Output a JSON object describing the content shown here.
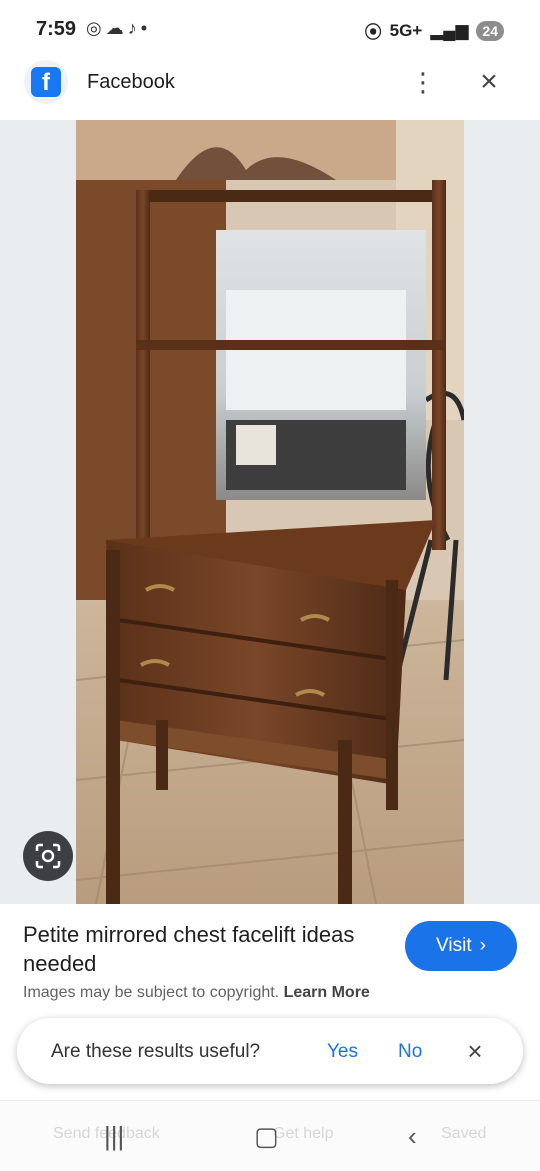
{
  "status": {
    "time": "7:59",
    "left_icons": [
      "whatsapp-icon",
      "cloud-icon",
      "tiktok-icon",
      "dot-icon"
    ],
    "network": "5G+",
    "battery": "24"
  },
  "header": {
    "title": "Facebook",
    "logo_icon": "facebook-icon",
    "logo_letter": "f",
    "accent": "#1877f2"
  },
  "result": {
    "title": "Petite mirrored chest facelift ideas needed",
    "visit_label": "Visit",
    "copyright_text": "Images may be subject to copyright.",
    "learn_more": "Learn More"
  },
  "feedback": {
    "question": "Are these results useful?",
    "yes": "Yes",
    "no": "No"
  },
  "bottom_bar": {
    "send_feedback": "Send feedback",
    "get_help": "Get help",
    "saved": "Saved"
  },
  "colors": {
    "button_blue": "#1a73e8",
    "lens_dark": "#3c4043"
  }
}
